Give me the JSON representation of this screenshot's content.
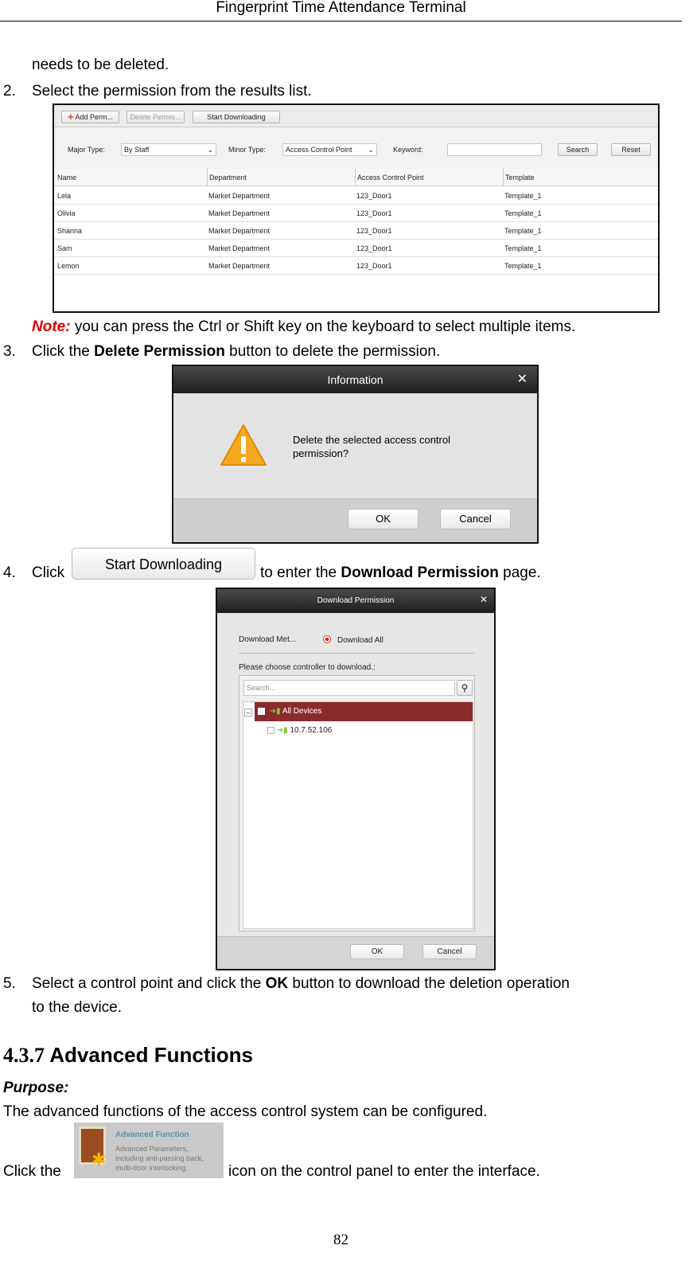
{
  "header": {
    "title": "Fingerprint Time Attendance Terminal"
  },
  "body": {
    "continuation": "needs to be deleted.",
    "step2": {
      "num": "2.",
      "text": "Select the permission from the results list."
    },
    "note": {
      "label": "Note:",
      "text": " you can press the Ctrl or Shift key on the keyboard to select multiple items."
    },
    "step3": {
      "num": "3.",
      "pre": "Click the ",
      "bold": "Delete Permission",
      "post": " button to delete the permission."
    },
    "step4": {
      "num": "4.",
      "pre": "Click ",
      "post": " to enter the ",
      "bold": "Download Permission",
      "post2": " page."
    },
    "step5": {
      "num": "5.",
      "pre": "Select a control point and click the ",
      "bold": "OK",
      "post": " button to download the deletion operation",
      "line2": "to the device."
    },
    "heading": {
      "num": "4.3.7",
      "title": "Advanced Functions"
    },
    "purpose_label": "Purpose:",
    "purpose_text": "The advanced functions of the access control system can be configured.",
    "click_pre": "Click the",
    "click_post": "icon on the control panel to enter the interface."
  },
  "permission_list": {
    "toolbar": {
      "add": "Add Perm...",
      "delete": "Delete Permis...",
      "download": "Start Downloading"
    },
    "filters": {
      "major_label": "Major Type:",
      "major_value": "By Staff",
      "minor_label": "Minor Type:",
      "minor_value": "Access Control Point",
      "keyword_label": "Keyword:",
      "keyword_value": "",
      "search": "Search",
      "reset": "Reset"
    },
    "columns": [
      "Name",
      "Department",
      "Access Control Point",
      "Template"
    ],
    "rows": [
      [
        "Lela",
        "Market Department",
        "123_Door1",
        "Template_1"
      ],
      [
        "Olivia",
        "Market Department",
        "123_Door1",
        "Template_1"
      ],
      [
        "Shanna",
        "Market Department",
        "123_Door1",
        "Template_1"
      ],
      [
        "Sam",
        "Market Department",
        "123_Door1",
        "Template_1"
      ],
      [
        "Lemon",
        "Market Department",
        "123_Door1",
        "Template_1"
      ]
    ]
  },
  "info_dialog": {
    "title": "Information",
    "message_l1": "Delete the selected access control",
    "message_l2": "permission?",
    "ok": "OK",
    "cancel": "Cancel"
  },
  "start_button": {
    "label": "Start Downloading"
  },
  "download_dialog": {
    "title": "Download Permission",
    "method_label": "Download Met...",
    "method_option": "Download All",
    "choose_label": "Please choose controller to download.:",
    "search_placeholder": "Search...",
    "tree": {
      "root": "All Devices",
      "child": "10.7.52.106"
    },
    "ok": "OK",
    "cancel": "Cancel"
  },
  "advanced_icon": {
    "title": "Advanced Function",
    "desc_l1": "Advanced Parameters,",
    "desc_l2": "including anti-passing back,",
    "desc_l3": "multi-door interlocking."
  },
  "footer": {
    "page": "82"
  },
  "colors": {
    "note": "#e00000",
    "tree_selected": "#8b2b2b",
    "dialog_title": "#2a2a2a"
  }
}
